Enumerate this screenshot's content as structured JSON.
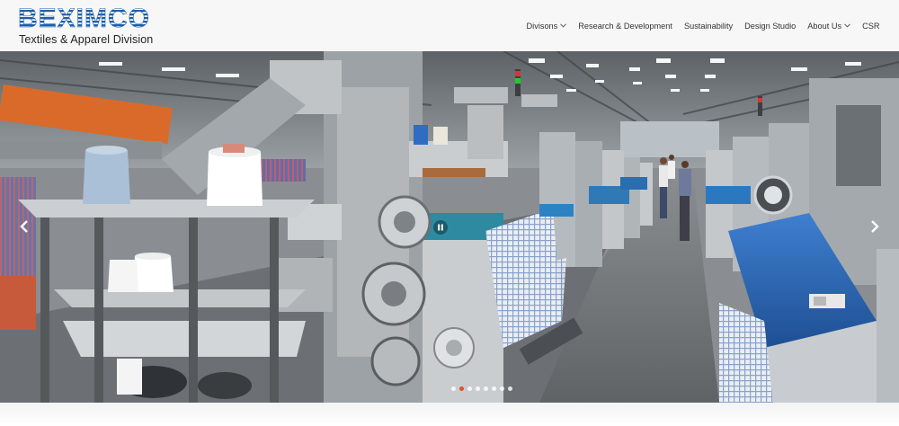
{
  "brand": {
    "logo_text": "BEXIMCO",
    "subtitle": "Textiles & Apparel Division",
    "logo_color": "#1f5fa8"
  },
  "nav": {
    "items": [
      {
        "label": "Divisons",
        "has_dropdown": true
      },
      {
        "label": "Research & Development",
        "has_dropdown": false
      },
      {
        "label": "Sustainability",
        "has_dropdown": false
      },
      {
        "label": "Design Studio",
        "has_dropdown": false
      },
      {
        "label": "About Us",
        "has_dropdown": true
      },
      {
        "label": "CSR",
        "has_dropdown": false
      }
    ]
  },
  "slider": {
    "slide_count": 8,
    "active_index": 1,
    "controls": {
      "prev_icon": "chevron-left-icon",
      "next_icon": "chevron-right-icon",
      "pause_icon": "pause-icon"
    },
    "accent_color": "#e0541e"
  }
}
